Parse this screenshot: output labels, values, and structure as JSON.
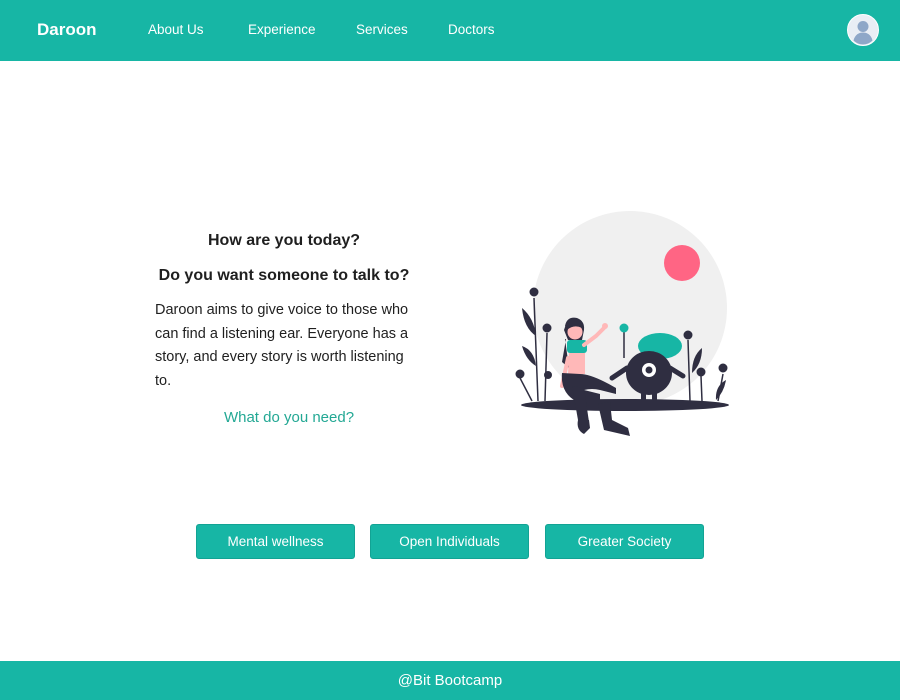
{
  "navbar": {
    "brand": "Daroon",
    "links": [
      "About Us",
      "Experience",
      "Services",
      "Doctors"
    ],
    "avatar_icon": "user-avatar-icon"
  },
  "hero": {
    "greeting": "How are you today?",
    "question": "Do you want someone to talk to?",
    "description": "Daroon aims to give voice to those who can find a listening ear. Everyone has a story, and every story is worth listening to.",
    "cta": "What do you need?"
  },
  "categories": [
    "Mental wellness",
    "Open Individuals",
    "Greater Society"
  ],
  "footer": {
    "text": "@Bit Bootcamp"
  },
  "colors": {
    "accent": "#17b6a5",
    "link": "#23a894",
    "sun": "#ff6584",
    "dark": "#2f2e41"
  }
}
